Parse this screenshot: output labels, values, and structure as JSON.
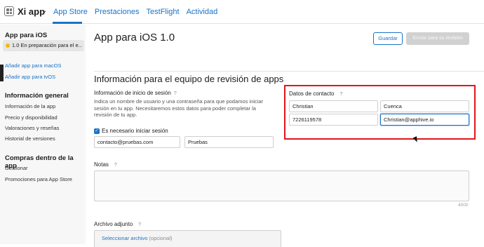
{
  "header": {
    "app_name": "Xi app",
    "tabs": [
      "App Store",
      "Prestaciones",
      "TestFlight",
      "Actividad"
    ]
  },
  "sidebar": {
    "platform_heading": "App para iOS",
    "version_label": "1.0 En preparación para el e...",
    "add_macos": "Añadir app para macOS",
    "add_tvos": "Añadir app para tvOS",
    "general_heading": "Información general",
    "general_items": [
      "Información de la app",
      "Precio y disponibilidad",
      "Valoraciones y reseñas",
      "Historial de versiones"
    ],
    "purchases_heading": "Compras dentro de la app",
    "purchases_items": [
      "Gestionar",
      "Promociones para App Store"
    ]
  },
  "main": {
    "title": "App para iOS 1.0",
    "save_label": "Guardar",
    "submit_label": "Enviar para su revisión",
    "section_title": "Información para el equipo de revisión de apps",
    "login": {
      "label": "Información de inicio de sesión",
      "help": "?",
      "description": "Indica un nombre de usuario y una contraseña para que podamos iniciar sesión en tu app. Necesitaremos estos datos para poder completar la revisión de tu app.",
      "checkbox_label": "Es necesario iniciar sesión",
      "username": "contacto@pruebas.com",
      "password": "Pruebas"
    },
    "contact": {
      "label": "Datos de contacto",
      "help": "?",
      "first_name": "Christian",
      "last_name": "Cuenca",
      "phone": "7226119578",
      "email": "Christian@apphive.io"
    },
    "notes": {
      "label": "Notas",
      "help": "?",
      "counter": "4000"
    },
    "attachment": {
      "label": "Archivo adjunto",
      "help": "?",
      "link": "Seleccionar archivo",
      "optional": "(opcional)"
    }
  },
  "colors": {
    "accent": "#1a73c6",
    "highlight_box": "#e0161b",
    "status_dot": "#f5b912"
  }
}
